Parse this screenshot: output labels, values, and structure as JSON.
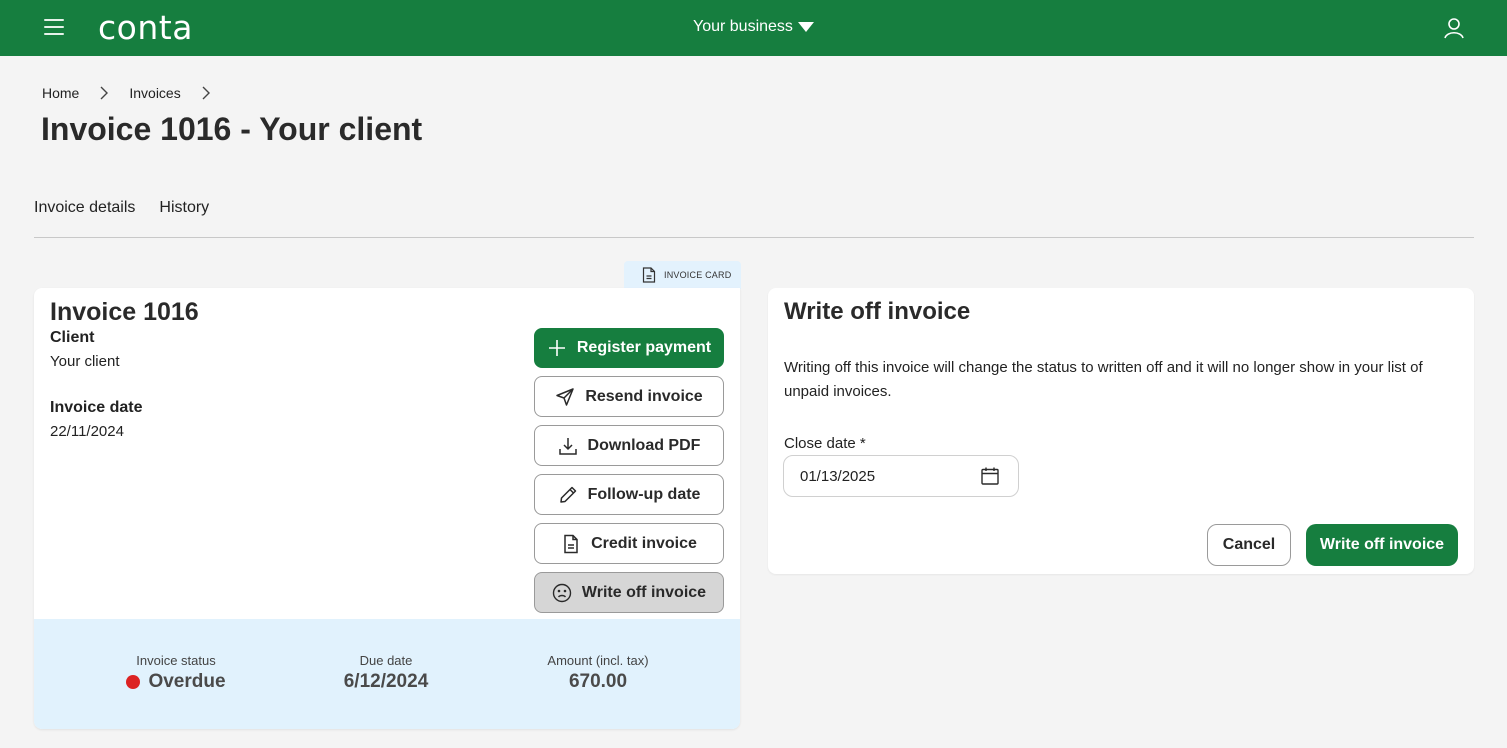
{
  "topbar": {
    "logo": "conta",
    "business_label": "Your business",
    "icons": {
      "menu": "hamburger-icon",
      "dropdown": "caret-down-icon",
      "user": "user-icon"
    }
  },
  "breadcrumb": [
    {
      "label": "Home"
    },
    {
      "label": "Invoices"
    }
  ],
  "page_title": "Invoice 1016 - Your client",
  "tabs": [
    {
      "label": "Invoice details",
      "active": true
    },
    {
      "label": "History",
      "active": false
    }
  ],
  "invoice_card": {
    "tag_label": "INVOICE CARD",
    "title": "Invoice 1016",
    "client_label": "Client",
    "client_value": "Your client",
    "invoice_date_label": "Invoice date",
    "invoice_date_value": "22/11/2024",
    "actions": [
      {
        "label": "Register payment",
        "icon": "plus-icon",
        "variant": "primary"
      },
      {
        "label": "Resend invoice",
        "icon": "send-icon",
        "variant": "outline"
      },
      {
        "label": "Download PDF",
        "icon": "download-icon",
        "variant": "outline"
      },
      {
        "label": "Follow-up date",
        "icon": "pencil-icon",
        "variant": "outline"
      },
      {
        "label": "Credit invoice",
        "icon": "document-icon",
        "variant": "outline"
      },
      {
        "label": "Write off invoice",
        "icon": "sad-face-icon",
        "variant": "active"
      }
    ],
    "summary": {
      "status_label": "Invoice status",
      "status_value": "Overdue",
      "status_color": "#dc2323",
      "due_label": "Due date",
      "due_value": "6/12/2024",
      "amount_label": "Amount (incl. tax)",
      "amount_value": "670.00"
    }
  },
  "write_off": {
    "title": "Write off invoice",
    "description": "Writing off this invoice will change the status to written off and it will no longer show in your list of unpaid invoices.",
    "close_date_label": "Close date *",
    "close_date_value": "01/13/2025",
    "cancel_label": "Cancel",
    "submit_label": "Write off invoice"
  },
  "colors": {
    "brand_green": "#167e3f",
    "summary_bg": "#e1f2fd",
    "overdue_red": "#dc2323"
  }
}
